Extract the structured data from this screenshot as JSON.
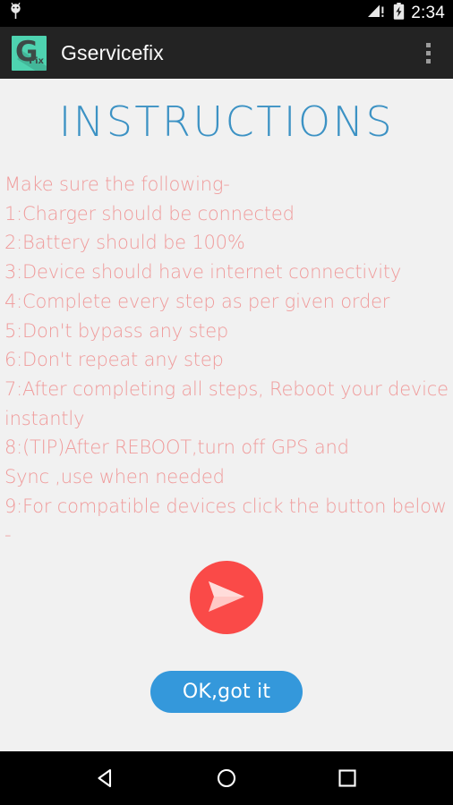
{
  "status_bar": {
    "notification_icon": "android-notification-icon",
    "signal_icon": "signal-bar-warning-icon",
    "battery_icon": "battery-charging-icon",
    "clock": "2:34",
    "background_color": "#000000"
  },
  "app_bar": {
    "icon_letter": "G",
    "icon_subscript": "Fix",
    "icon_background_color": "#4ed3b0",
    "title": "Gservicefix",
    "overflow_icon": "overflow-menu-icon",
    "background_color": "#232323"
  },
  "page": {
    "heading": "INSTRUCTIONS",
    "heading_color": "#3c92c4",
    "background_color": "#f1f1f1",
    "text_color": "#f09b9b"
  },
  "instructions": [
    "Make sure the following-",
    "1:Charger should be connected",
    "2:Battery should be 100%",
    "3:Device should have internet connectivity",
    "4:Complete every step as per given order",
    "5:Don't bypass any step",
    "6:Don't repeat any step",
    "7:After completing all steps, Reboot your device",
    "instantly",
    "8:(TIP)After REBOOT,turn off GPS and",
    "Sync ,use when needed",
    "9:For compatible devices click the button below",
    "-"
  ],
  "fab": {
    "icon": "send-icon",
    "color": "#fa4a48",
    "icon_color": "#ffc9c6"
  },
  "primary_button": {
    "label": "OK,got it",
    "color": "#3498db",
    "text_color": "#ffffff"
  },
  "nav_bar": {
    "back_icon": "back-triangle-icon",
    "home_icon": "home-circle-icon",
    "recents_icon": "recents-square-icon",
    "background_color": "#000000"
  }
}
